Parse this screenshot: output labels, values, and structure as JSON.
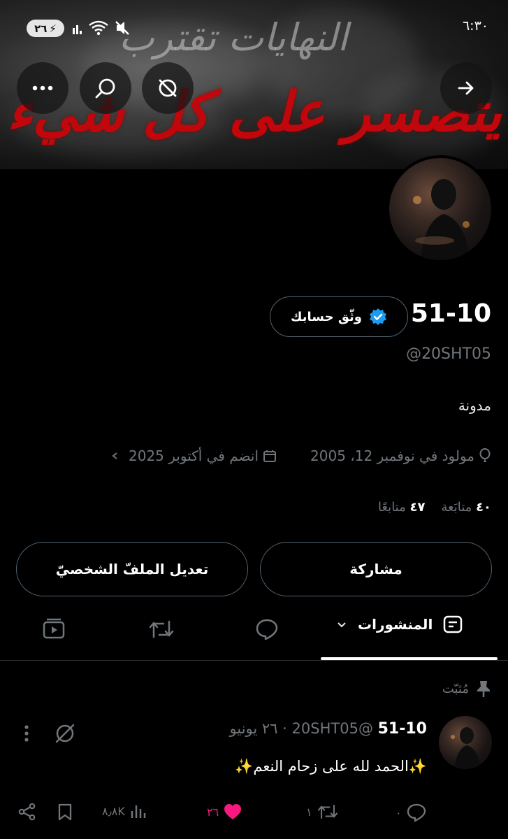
{
  "status_bar": {
    "time": "٦:٣٠",
    "battery": "٢٦"
  },
  "banner": {
    "grey_text": "النهايات تقترب",
    "red_text": "الموت يتصسر على كل شيء"
  },
  "header_buttons": {
    "forward": "arrow-right-icon",
    "cancel": "slash-circle-icon",
    "search": "search-icon",
    "more": "more-dots-icon"
  },
  "profile": {
    "name": "51-10",
    "verify_label": "وثّق حسابك",
    "handle": "@20SHT05",
    "bio": "مدونة",
    "born": "مولود في نوفمبر 12، 2005",
    "joined": "انضم في أكتوبر 2025",
    "following_count": "٤٠",
    "following_label": "متابَعة",
    "followers_count": "٤٧",
    "followers_label": "متابعًا"
  },
  "buttons": {
    "share": "مشاركة",
    "edit_profile": "تعديل الملفّ الشخصيّ"
  },
  "tabs": {
    "posts": "المنشورات"
  },
  "pinned_post": {
    "pinned_label": "مُثبّت",
    "author": "51-10",
    "handle": "@20SHT05",
    "date": "· ٢٦ يونيو",
    "text": "✨الحمد لله على زحام النعم✨",
    "replies": "٠",
    "reposts": "١",
    "likes": "٢٦",
    "views": "٨٫٨K"
  },
  "colors": {
    "accent": "#1d9bf0",
    "like": "#f91880",
    "banner_red": "#c2070c"
  }
}
